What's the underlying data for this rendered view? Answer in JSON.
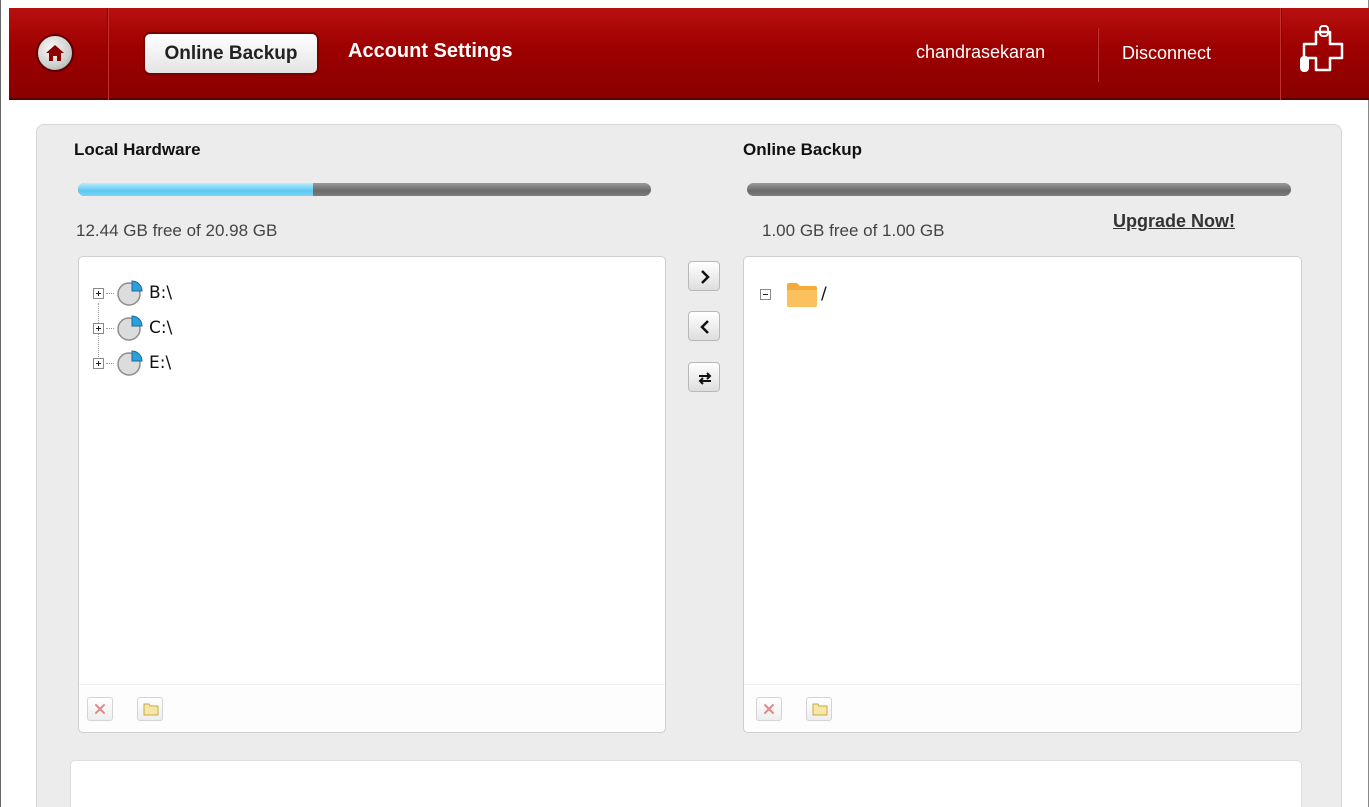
{
  "header": {
    "nav": {
      "online_backup": "Online Backup",
      "account_settings": "Account Settings"
    },
    "username": "chandrasekaran",
    "disconnect": "Disconnect"
  },
  "local": {
    "title": "Local Hardware",
    "free": "12.44",
    "free_unit": "GB free of",
    "total": "20.98",
    "total_unit": "GB",
    "used_fraction": 0.41,
    "drives": [
      {
        "label": "B:\\"
      },
      {
        "label": "C:\\"
      },
      {
        "label": "E:\\"
      }
    ]
  },
  "online": {
    "title": "Online Backup",
    "free": "1.00",
    "free_unit": "GB free of",
    "total": "1.00",
    "total_unit": "GB",
    "used_fraction": 0.0,
    "upgrade": "Upgrade Now!",
    "root_label": "/"
  },
  "colors": {
    "header_red": "#9d0000",
    "usage_blue": "#5cc8f2",
    "folder_orange": "#f7a93a",
    "drive_blue": "#2aa0dc"
  },
  "icons": [
    "home-icon",
    "logo-icon",
    "drive-icon",
    "folder-icon",
    "delete-icon",
    "new-folder-icon",
    "arrow-right-icon",
    "arrow-left-icon",
    "sync-icon"
  ]
}
